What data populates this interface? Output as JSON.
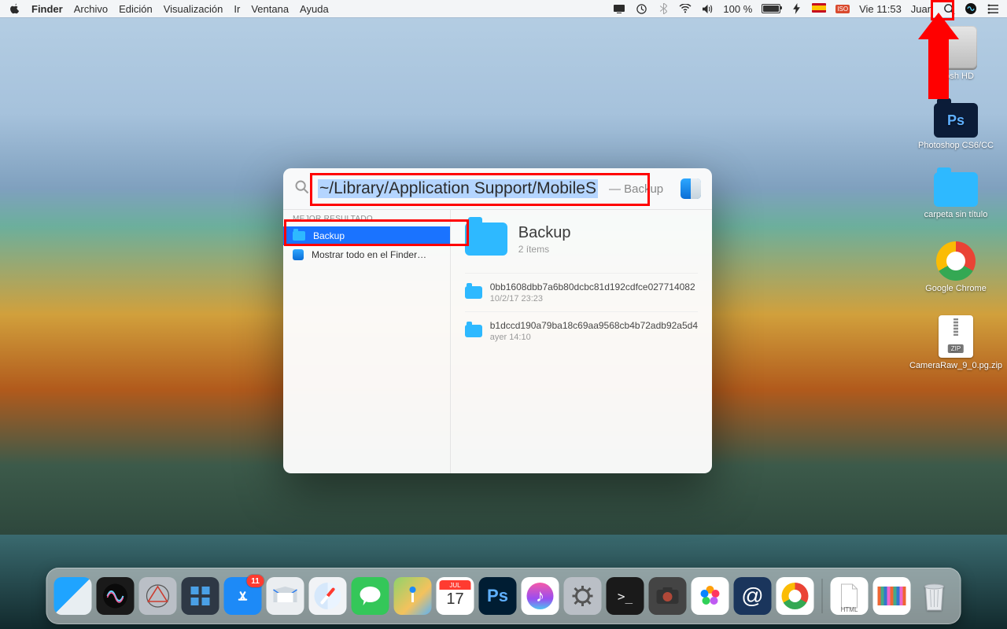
{
  "menubar": {
    "app": "Finder",
    "items": [
      "Archivo",
      "Edición",
      "Visualización",
      "Ir",
      "Ventana",
      "Ayuda"
    ],
    "battery_pct": "100 %",
    "iso_label": "ISO",
    "datetime": "Vie 11:53",
    "user": "Juan"
  },
  "desktop_icons": {
    "hd": "ntosh HD",
    "ps_folder": "Photoshop CS6/CC",
    "untitled_folder": "carpeta sin título",
    "chrome": "Google Chrome",
    "zip": "CameraRaw_9_0.pg.zip",
    "zip_tag": "ZIP"
  },
  "spotlight": {
    "query": "~/Library/Application Support/MobileS",
    "query_hint": "— Backup",
    "section_best": "MEJOR RESULTADO",
    "result_backup": "Backup",
    "result_showall": "Mostrar todo en el Finder…",
    "preview": {
      "name": "Backup",
      "meta": "2 ítems",
      "items": [
        {
          "name": "0bb1608dbb7a6b80dcbc81d192cdfce027714082",
          "date": "10/2/17 23:23"
        },
        {
          "name": "b1dccd190a79ba18c69aa9568cb4b72adb92a5d4",
          "date": "ayer 14:10"
        }
      ]
    }
  },
  "dock": {
    "appstore_badge": "11",
    "cal_month": "JUL",
    "cal_day": "17",
    "ps_label": "Ps",
    "html_label": "HTML"
  }
}
